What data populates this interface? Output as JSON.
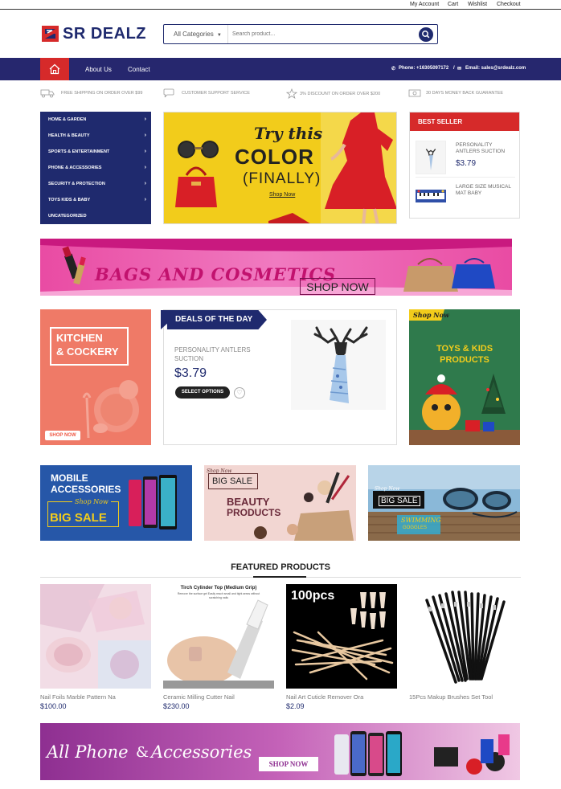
{
  "toplinks": [
    "My Account",
    "Cart",
    "Wishlist",
    "Checkout"
  ],
  "logo": {
    "text": "SR DEALZ"
  },
  "search": {
    "category": "All Categories",
    "placeholder": "Search product..."
  },
  "nav": {
    "about": "About Us",
    "contact": "Contact",
    "phone": "Phone: +16305097172",
    "email": "Email: sales@srdealz.com"
  },
  "features": [
    "FREE SHIPPING ON ORDER OVER $99",
    "CUSTOMER SUPPORT SERVICE",
    "3% DISCOUNT ON ORDER OVER $200",
    "30 DAYS MONEY BACK GUARANTEE"
  ],
  "categories": [
    "HOME & GARDEN",
    "HEALTH & BEAUTY",
    "SPORTS & ENTERTAINMENT",
    "PHONE & ACCESSORIES",
    "SECURITY & PROTECTION",
    "TOYS KIDS & BABY",
    "UNCATEGORIZED"
  ],
  "hero": {
    "line1": "Try this",
    "line2": "COLOR",
    "line3": "(FINALLY)",
    "cta": "Shop Now"
  },
  "bestseller": {
    "title": "BEST SELLER",
    "items": [
      {
        "name": "PERSONALITY ANTLERS SUCTION",
        "price": "$3.79"
      },
      {
        "name": "LARGE SIZE MUSICAL MAT BABY",
        "price": ""
      }
    ]
  },
  "banner_bags": {
    "title": "BAGS AND COSMETICS",
    "cta": "SHOP NOW"
  },
  "kitchen": {
    "title_line1": "KITCHEN",
    "title_line2": "& COCKERY",
    "cta": "SHOP NOW"
  },
  "deal": {
    "ribbon": "DEALS OF THE DAY",
    "name": "PERSONALITY ANTLERS SUCTION",
    "price": "$3.79",
    "button": "SELECT OPTIONS"
  },
  "toys": {
    "tag": "Shop Now",
    "title_line1": "TOYS & KIDS",
    "title_line2": "PRODUCTS"
  },
  "mobile": {
    "title_line1": "MOBILE",
    "title_line2": "ACCESSORIES",
    "tag": "Shop Now",
    "sale": "BIG SALE"
  },
  "beauty": {
    "tag": "Shop Now",
    "sale": "BIG SALE",
    "title_line1": "BEAUTY",
    "title_line2": "PRODUCTS"
  },
  "swimming": {
    "tag": "Shop Now",
    "sale": "BIG SALE",
    "title_line1": "SWIMMING",
    "title_line2": "GOGGLES"
  },
  "featured": {
    "title": "FEATURED PRODUCTS",
    "products": [
      {
        "name": "Nail Foils Marble Pattern Na",
        "price": "$100.00"
      },
      {
        "name": "Ceramic Milling Cutter Nail",
        "price": "$230.00",
        "img_title": "Tirch Cylinder Top (Medium Grip)",
        "img_sub": "Remove the surface gel Easily reach small and tight areas without scratching nails"
      },
      {
        "name": "Nail Art Cuticle Remover Ora",
        "price": "$2.09",
        "img_title": "100pcs"
      },
      {
        "name": "15Pcs Makup Brushes Set Tool",
        "price": ""
      }
    ]
  },
  "banner_phone": {
    "title_part1": "All Phone",
    "title_amp": "&",
    "title_part2": "Accessories",
    "cta": "SHOP NOW"
  },
  "colors": {
    "navy": "#1f2a6e",
    "red": "#d62a2a",
    "yellow": "#f2cc1b",
    "pink": "#e94ba3",
    "coral": "#ef7a67",
    "green": "#2f7a4c",
    "blue": "#2657a8",
    "purple": "#8e2f91"
  }
}
